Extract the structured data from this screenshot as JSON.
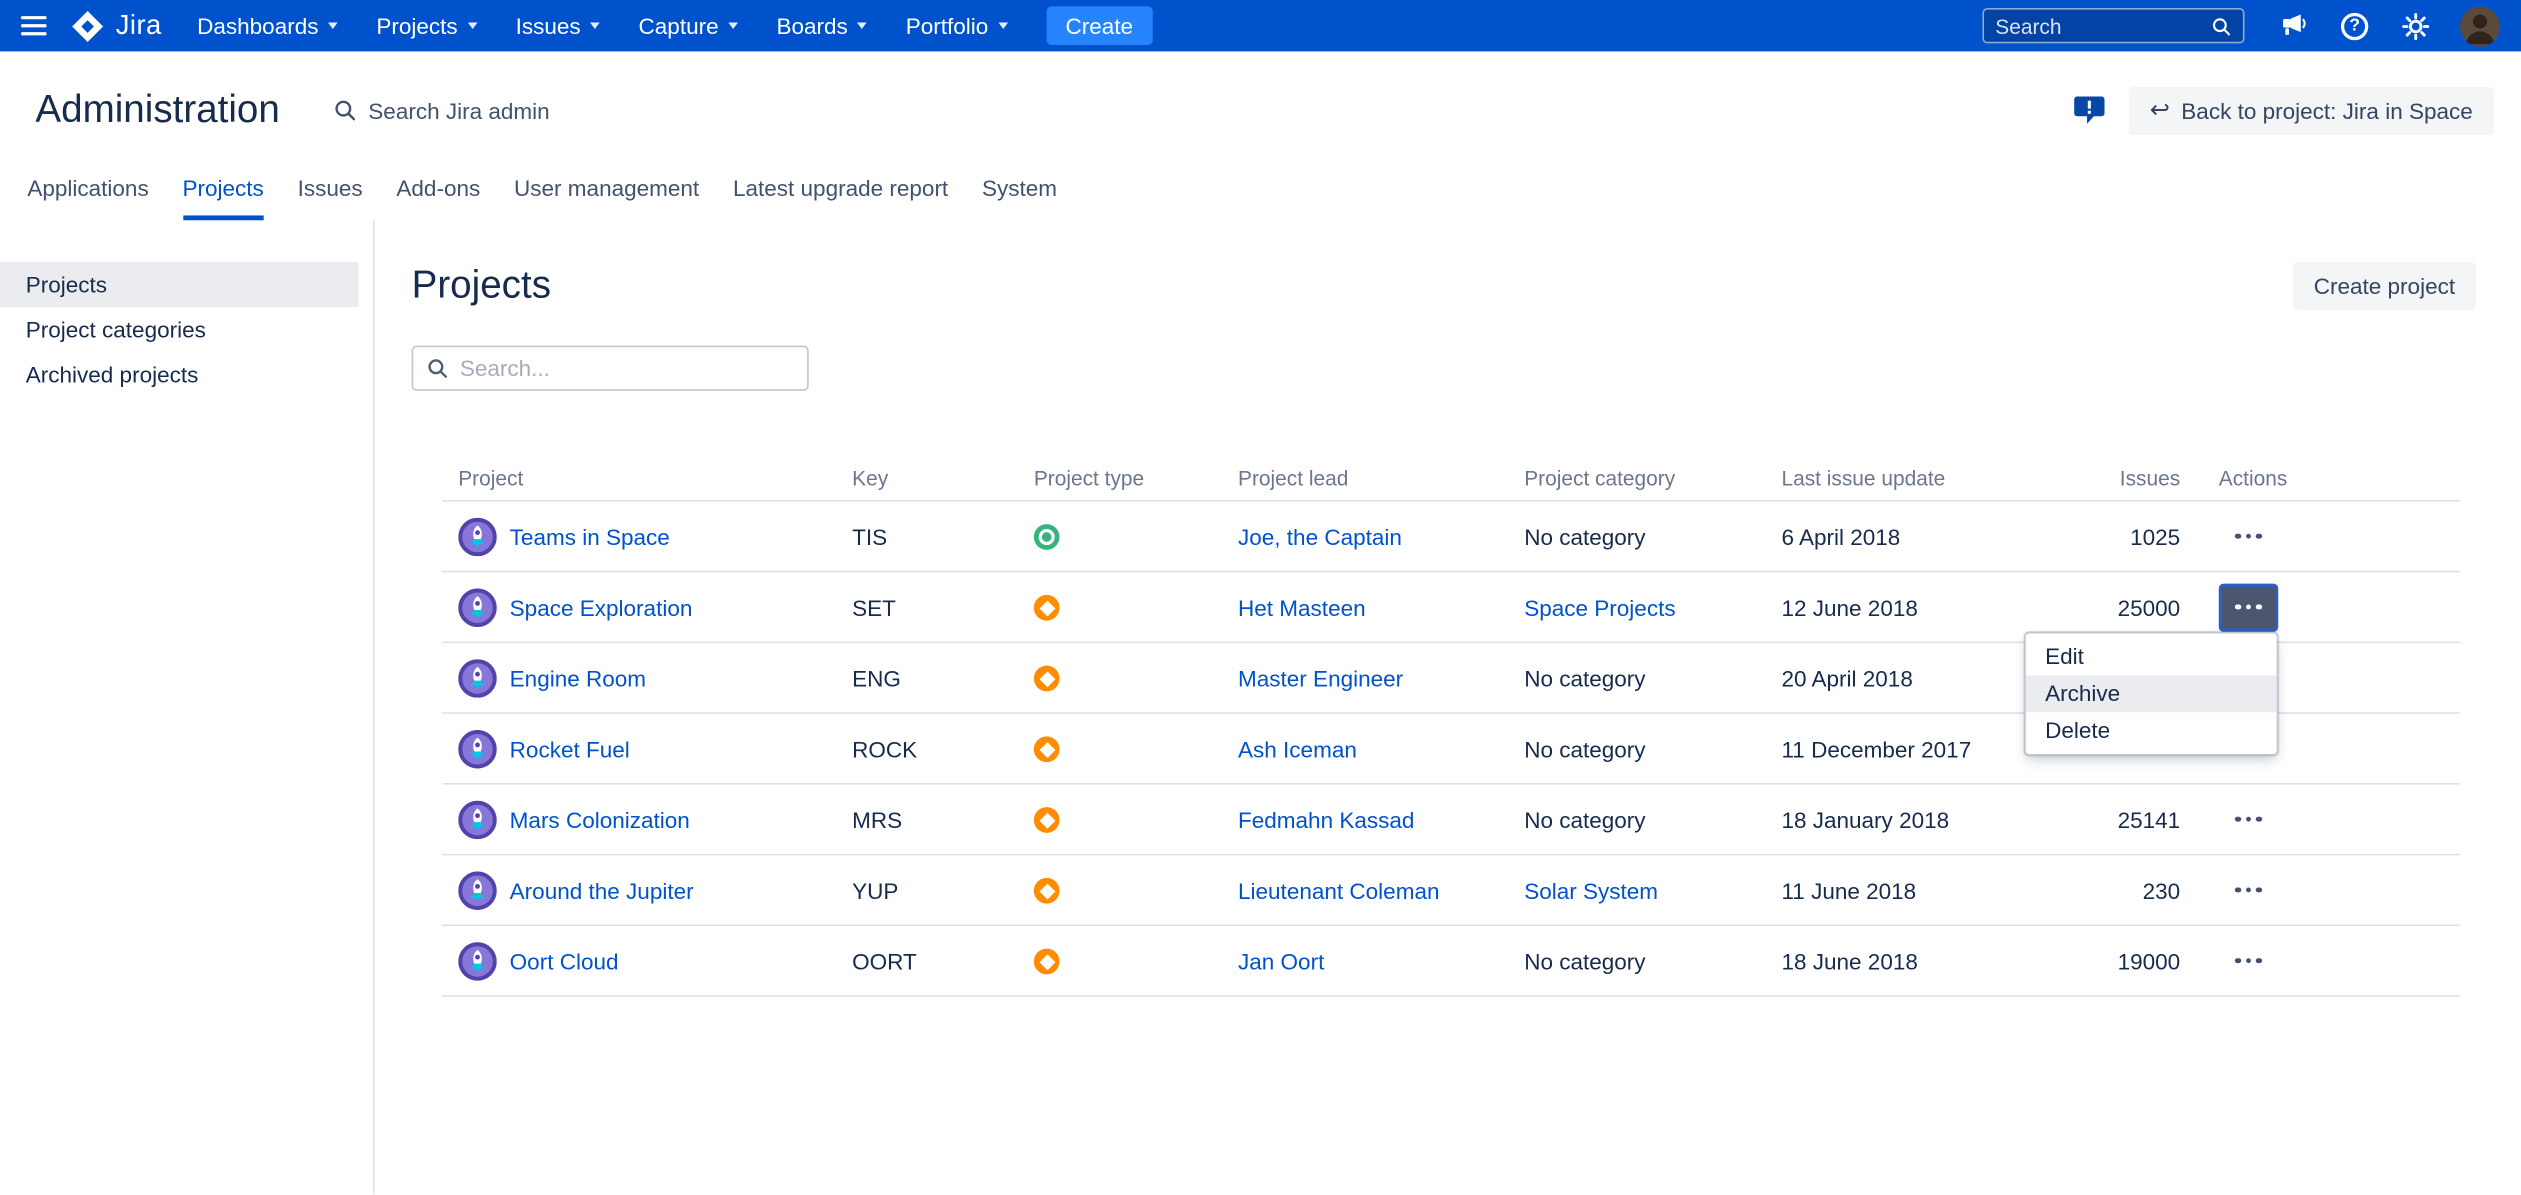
{
  "navbar": {
    "brand": "Jira",
    "items": [
      {
        "label": "Dashboards"
      },
      {
        "label": "Projects"
      },
      {
        "label": "Issues"
      },
      {
        "label": "Capture"
      },
      {
        "label": "Boards"
      },
      {
        "label": "Portfolio"
      }
    ],
    "create_label": "Create",
    "search_placeholder": "Search",
    "help_glyph": "?"
  },
  "header": {
    "title": "Administration",
    "admin_search_label": "Search Jira admin",
    "back_button_label": "Back to project: Jira in Space",
    "back_icon_glyph": "↩"
  },
  "tabs": {
    "items": [
      "Applications",
      "Projects",
      "Issues",
      "Add-ons",
      "User management",
      "Latest upgrade report",
      "System"
    ],
    "active": "Projects"
  },
  "sidebar": {
    "items": [
      "Projects",
      "Project categories",
      "Archived projects"
    ],
    "selected": "Projects"
  },
  "main": {
    "title": "Projects",
    "create_button": "Create project",
    "search_placeholder": "Search...",
    "columns": [
      "Project",
      "Key",
      "Project type",
      "Project lead",
      "Project category",
      "Last issue update",
      "Issues",
      "Actions"
    ],
    "rows": [
      {
        "name": "Teams in Space",
        "key": "TIS",
        "type": "software",
        "lead": "Joe, the Captain",
        "category": "No category",
        "updated": "6 April 2018",
        "issues": "1025"
      },
      {
        "name": "Space Exploration",
        "key": "SET",
        "type": "business",
        "lead": "Het Masteen",
        "category": "Space Projects",
        "updated": "12 June 2018",
        "issues": "25000"
      },
      {
        "name": "Engine Room",
        "key": "ENG",
        "type": "business",
        "lead": "Master Engineer",
        "category": "No category",
        "updated": "20 April 2018",
        "issues": ""
      },
      {
        "name": "Rocket Fuel",
        "key": "ROCK",
        "type": "business",
        "lead": "Ash Iceman",
        "category": "No category",
        "updated": "11 December 2017",
        "issues": ""
      },
      {
        "name": "Mars Colonization",
        "key": "MRS",
        "type": "business",
        "lead": "Fedmahn Kassad",
        "category": "No category",
        "updated": "18 January 2018",
        "issues": "25141"
      },
      {
        "name": "Around the Jupiter",
        "key": "YUP",
        "type": "business",
        "lead": "Lieutenant Coleman",
        "category": "Solar System",
        "updated": "11 June 2018",
        "issues": "230"
      },
      {
        "name": "Oort Cloud",
        "key": "OORT",
        "type": "business",
        "lead": "Jan Oort",
        "category": "No category",
        "updated": "18 June 2018",
        "issues": "19000"
      }
    ]
  },
  "context_menu": {
    "items": [
      "Edit",
      "Archive",
      "Delete"
    ],
    "highlighted": "Archive",
    "for_row": "Space Exploration"
  },
  "colors": {
    "navbar_blue": "#0052CC",
    "link_blue": "#0052CC",
    "create_button_blue": "#2684FF",
    "type_software_green": "#36B37E",
    "type_business_orange": "#FF8B00",
    "feedback_icon_blue": "#0747A6"
  }
}
